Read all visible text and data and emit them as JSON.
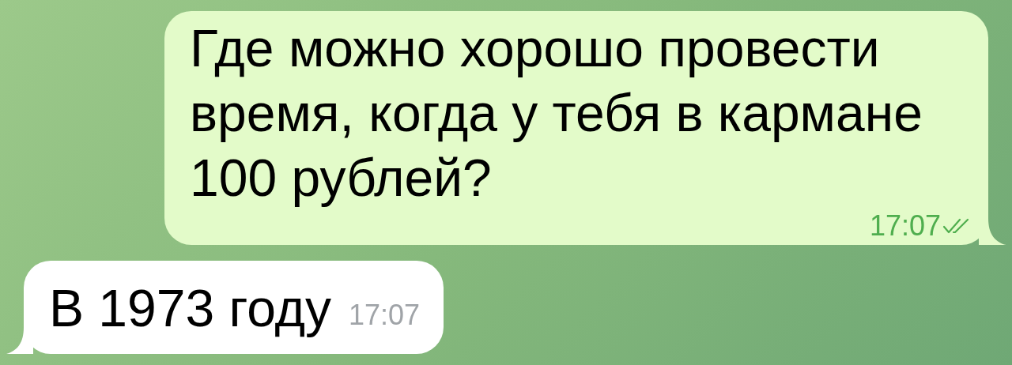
{
  "messages": [
    {
      "kind": "outgoing",
      "text": "Где можно хорошо провести время, когда у тебя в кармане 100 рублей?",
      "time": "17:07",
      "read": true
    },
    {
      "kind": "incoming",
      "text": "В 1973 году",
      "time": "17:07"
    }
  ]
}
